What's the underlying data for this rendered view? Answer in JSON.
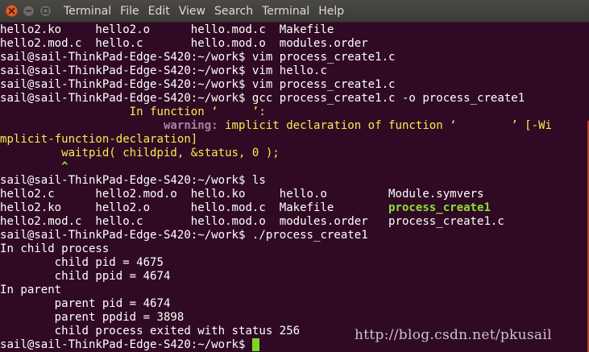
{
  "window": {
    "close_icon": "close-icon",
    "minimize_icon": "minimize-icon",
    "maximize_icon": "maximize-icon"
  },
  "menu": [
    "Terminal",
    "File",
    "Edit",
    "View",
    "Search",
    "Terminal",
    "Help"
  ],
  "colors": {
    "background": "#300a24",
    "foreground": "#ffffff",
    "green": "#8ae234",
    "yellow": "#fce94f",
    "magenta": "#ad7fa8",
    "cursor": "#7ed321"
  },
  "terminal": {
    "lines": [
      [
        {
          "t": "hello2.ko     hello2.o      hello.mod.c  Makefile"
        }
      ],
      [
        {
          "t": "hello2.mod.c  hello.c       hello.mod.o  modules.order"
        }
      ],
      [
        {
          "t": "sail@sail-ThinkPad-Edge-S420:~/work$ vim process_create1.c"
        }
      ],
      [
        {
          "t": "sail@sail-ThinkPad-Edge-S420:~/work$ vim hello.c"
        }
      ],
      [
        {
          "t": "sail@sail-ThinkPad-Edge-S420:~/work$ vim process_create1.c"
        }
      ],
      [
        {
          "t": "sail@sail-ThinkPad-Edge-S420:~/work$ gcc process_create1.c -o process_create1"
        }
      ],
      [
        {
          "t": "                   In function ‘     ’:",
          "c": "c-yellow"
        }
      ],
      [
        {
          "t": "                        "
        },
        {
          "t": "warning:",
          "c": "c-magenta-bold"
        },
        {
          "t": " implicit declaration of function ‘        ’ [-Wi",
          "c": "c-yellow"
        }
      ],
      [
        {
          "t": "mplicit-function-declaration]",
          "c": "c-yellow"
        }
      ],
      [
        {
          "t": "         waitpid( childpid, &status, 0 );",
          "c": "c-yellow"
        }
      ],
      [
        {
          "t": "         ^",
          "c": "c-green-bold-caret"
        }
      ],
      [
        {
          "t": "sail@sail-ThinkPad-Edge-S420:~/work$ ls"
        }
      ],
      [
        {
          "t": "hello2.c      hello2.mod.o  hello.ko     hello.o         Module.symvers"
        }
      ],
      [
        {
          "t": "hello2.ko     hello2.o      hello.mod.c  Makefile        "
        },
        {
          "t": "process_create1",
          "c": "c-green-bold"
        }
      ],
      [
        {
          "t": "hello2.mod.c  hello.c       hello.mod.o  modules.order   process_create1.c"
        }
      ],
      [
        {
          "t": "sail@sail-ThinkPad-Edge-S420:~/work$ ./process_create1"
        }
      ],
      [
        {
          "t": "In child process"
        }
      ],
      [
        {
          "t": "        child pid = 4675"
        }
      ],
      [
        {
          "t": "        child ppid = 4674"
        }
      ],
      [
        {
          "t": "In parent"
        }
      ],
      [
        {
          "t": "        parent pid = 4674"
        }
      ],
      [
        {
          "t": "        parent ppdid = 3898"
        }
      ],
      [
        {
          "t": "        child process exited with status 256"
        }
      ],
      [
        {
          "t": "sail@sail-ThinkPad-Edge-S420:~/work$ "
        },
        {
          "cursor": true
        }
      ]
    ]
  },
  "watermark": "http://blog.csdn.net/pkusail"
}
